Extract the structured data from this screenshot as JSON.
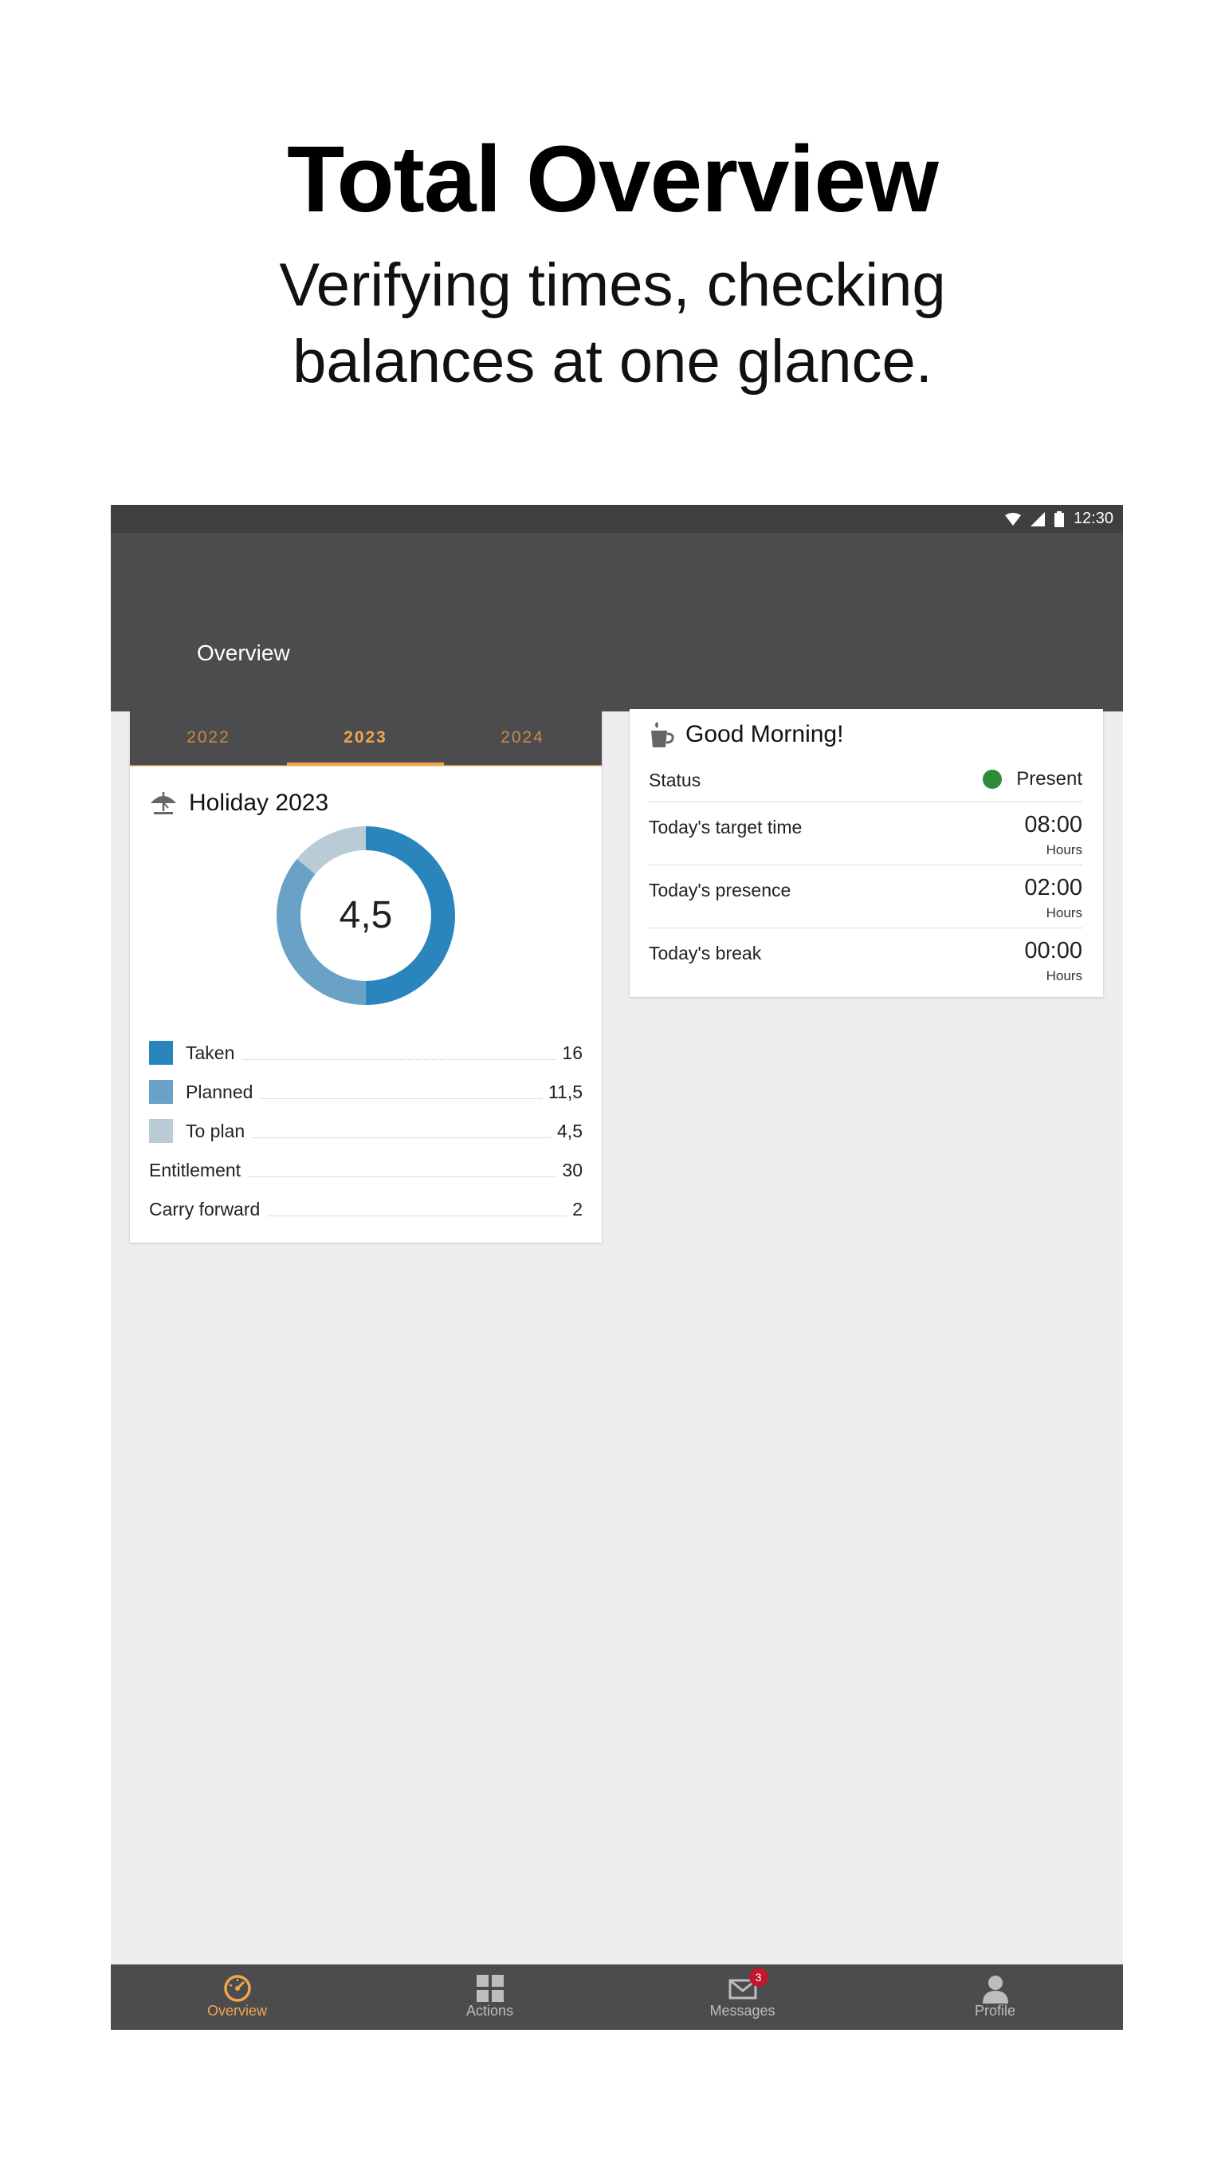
{
  "hero": {
    "title": "Total Overview",
    "subtitle_line1": "Verifying times, checking",
    "subtitle_line2": "balances at one glance."
  },
  "status_bar": {
    "time": "12:30",
    "icons": [
      "wifi-icon",
      "signal-icon",
      "battery-icon"
    ]
  },
  "app_bar": {
    "title": "Overview"
  },
  "holiday_card": {
    "tabs": [
      {
        "label": "2022",
        "active": false
      },
      {
        "label": "2023",
        "active": true
      },
      {
        "label": "2024",
        "active": false
      }
    ],
    "title": "Holiday 2023",
    "icon": "umbrella-icon",
    "center_value": "4,5",
    "chart_data": {
      "type": "pie",
      "title": "Holiday 2023",
      "categories": [
        "Taken",
        "Planned",
        "To plan"
      ],
      "values": [
        16,
        11.5,
        4.5
      ],
      "colors": [
        "#2a85bd",
        "#6aa2c7",
        "#b9cbd5"
      ]
    },
    "legend": [
      {
        "label": "Taken",
        "value": "16",
        "color": "#2a85bd"
      },
      {
        "label": "Planned",
        "value": "11,5",
        "color": "#6aa2c7"
      },
      {
        "label": "To plan",
        "value": "4,5",
        "color": "#b9cbd5"
      }
    ],
    "summary": [
      {
        "label": "Entitlement",
        "value": "30"
      },
      {
        "label": "Carry forward",
        "value": "2"
      }
    ]
  },
  "morning_card": {
    "icon": "coffee-cup-icon",
    "title": "Good Morning!",
    "status": {
      "label": "Status",
      "value": "Present",
      "color": "#2e8b3a"
    },
    "rows": [
      {
        "label": "Today's target time",
        "value": "08:00",
        "unit": "Hours"
      },
      {
        "label": "Today's presence",
        "value": "02:00",
        "unit": "Hours"
      },
      {
        "label": "Today's break",
        "value": "00:00",
        "unit": "Hours"
      }
    ]
  },
  "bottom_nav": [
    {
      "label": "Overview",
      "icon": "speedometer-icon",
      "active": true
    },
    {
      "label": "Actions",
      "icon": "grid-icon",
      "active": false
    },
    {
      "label": "Messages",
      "icon": "envelope-icon",
      "active": false,
      "badge": "3"
    },
    {
      "label": "Profile",
      "icon": "person-icon",
      "active": false
    }
  ],
  "colors": {
    "accent": "#f0a64c",
    "bar": "#4c4c4e",
    "background": "#eeedef",
    "badge": "#c0182c"
  }
}
